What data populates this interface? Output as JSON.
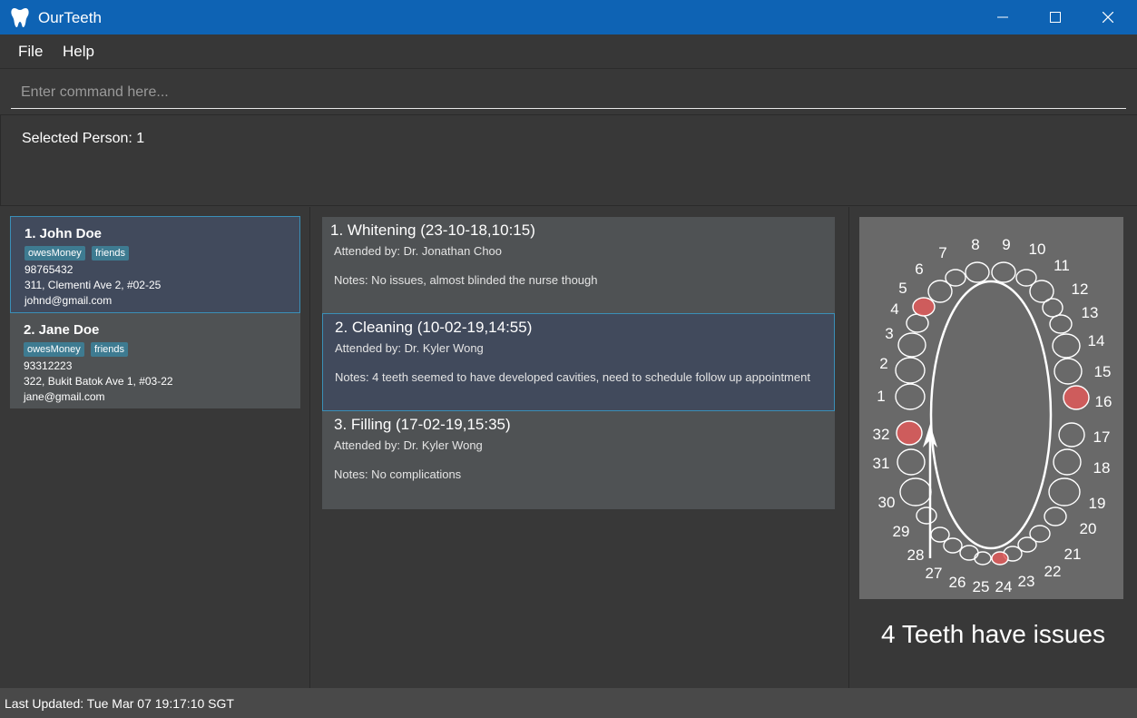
{
  "app": {
    "title": "OurTeeth"
  },
  "menu": {
    "file": "File",
    "help": "Help"
  },
  "command": {
    "placeholder": "Enter command here..."
  },
  "result": {
    "text": "Selected Person: 1"
  },
  "persons": [
    {
      "name": "1. John Doe",
      "tags": [
        "owesMoney",
        "friends"
      ],
      "phone": "98765432",
      "address": "311, Clementi Ave 2, #02-25",
      "email": "johnd@gmail.com"
    },
    {
      "name": "2. Jane Doe",
      "tags": [
        "owesMoney",
        "friends"
      ],
      "phone": "93312223",
      "address": "322, Bukit Batok Ave 1, #03-22",
      "email": "jane@gmail.com"
    }
  ],
  "appointments": [
    {
      "title": "1. Whitening (23-10-18,10:15)",
      "attended": "Attended by: Dr. Jonathan Choo",
      "notes": "Notes: No issues, almost blinded the nurse though"
    },
    {
      "title": "2. Cleaning (10-02-19,14:55)",
      "attended": "Attended by: Dr. Kyler Wong",
      "notes": "Notes: 4 teeth seemed to have developed cavities, need to schedule follow up appointment"
    },
    {
      "title": "3. Filling (17-02-19,15:35)",
      "attended": "Attended by: Dr. Kyler Wong",
      "notes": "Notes: No complications"
    }
  ],
  "teeth": {
    "numbers": [
      "1",
      "2",
      "3",
      "4",
      "5",
      "6",
      "7",
      "8",
      "9",
      "10",
      "11",
      "12",
      "13",
      "14",
      "15",
      "16",
      "17",
      "18",
      "19",
      "20",
      "21",
      "22",
      "23",
      "24",
      "25",
      "26",
      "27",
      "28",
      "29",
      "30",
      "31",
      "32"
    ],
    "problem_teeth": [
      "5",
      "16",
      "24",
      "32"
    ],
    "summary": "4 Teeth have issues",
    "colors": {
      "problem": "#e05a5a",
      "tooth_outline": "#ffffff",
      "background": "#696969"
    }
  },
  "status": {
    "text": "Last Updated: Tue Mar 07 19:17:10 SGT"
  },
  "icons": {
    "app": "tooth-icon",
    "minimize": "minimize-icon",
    "maximize": "maximize-icon",
    "close": "close-icon"
  }
}
